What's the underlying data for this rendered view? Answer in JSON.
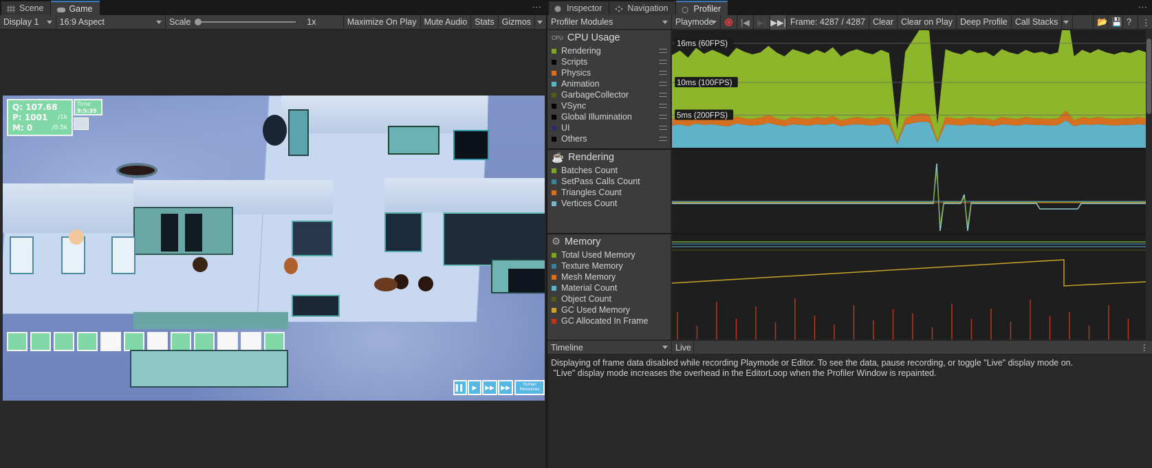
{
  "left_tabs": [
    {
      "name": "scene",
      "label": "Scene"
    },
    {
      "name": "game",
      "label": "Game"
    }
  ],
  "game_toolbar": {
    "display": "Display 1",
    "aspect": "16:9 Aspect",
    "scale_label": "Scale",
    "scale_value": "1x",
    "maximize": "Maximize On Play",
    "mute": "Mute Audio",
    "stats": "Stats",
    "gizmos": "Gizmos"
  },
  "hud": {
    "q": "Q: 107.68",
    "p": "P: 1001",
    "p_max": "/1k",
    "m": "M: 0",
    "m_max": "/0.5k",
    "time_label": "Time",
    "time": "9:5:39",
    "hr_button": "Human Resources"
  },
  "right_tabs": [
    {
      "name": "inspector",
      "label": "Inspector"
    },
    {
      "name": "navigation",
      "label": "Navigation"
    },
    {
      "name": "profiler",
      "label": "Profiler"
    }
  ],
  "profiler_toolbar": {
    "modules": "Profiler Modules",
    "target": "Playmode",
    "frame": "Frame: 4287 / 4287",
    "clear": "Clear",
    "clear_on_play": "Clear on Play",
    "deep_profile": "Deep Profile",
    "call_stacks": "Call Stacks"
  },
  "modules": {
    "cpu": {
      "title": "CPU Usage",
      "items": [
        {
          "label": "Rendering",
          "color": "#7ca42a"
        },
        {
          "label": "Scripts",
          "color": "#000000"
        },
        {
          "label": "Physics",
          "color": "#d4701f"
        },
        {
          "label": "Animation",
          "color": "#5fb3c8"
        },
        {
          "label": "GarbageCollector",
          "color": "#4f5b1e"
        },
        {
          "label": "VSync",
          "color": "#000000"
        },
        {
          "label": "Global Illumination",
          "color": "#000000"
        },
        {
          "label": "UI",
          "color": "#2a2a6a"
        },
        {
          "label": "Others",
          "color": "#000000"
        }
      ]
    },
    "rendering": {
      "title": "Rendering",
      "items": [
        {
          "label": "Batches Count",
          "color": "#7ca42a"
        },
        {
          "label": "SetPass Calls Count",
          "color": "#3f7f9a"
        },
        {
          "label": "Triangles Count",
          "color": "#d4701f"
        },
        {
          "label": "Vertices Count",
          "color": "#78b7c7"
        }
      ]
    },
    "memory": {
      "title": "Memory",
      "items": [
        {
          "label": "Total Used Memory",
          "color": "#7ca42a"
        },
        {
          "label": "Texture Memory",
          "color": "#3f7f9a"
        },
        {
          "label": "Mesh Memory",
          "color": "#d4701f"
        },
        {
          "label": "Material Count",
          "color": "#5fb3c8"
        },
        {
          "label": "Object Count",
          "color": "#4f5b1e"
        },
        {
          "label": "GC Used Memory",
          "color": "#c8a22a"
        },
        {
          "label": "GC Allocated In Frame",
          "color": "#b53a1f"
        }
      ]
    }
  },
  "chart_data": {
    "type": "area",
    "title": "CPU Usage",
    "markers": [
      "16ms (60FPS)",
      "10ms (100FPS)",
      "5ms (200FPS)"
    ],
    "series": [
      {
        "name": "Rendering",
        "values": [
          9.8,
          10.2,
          9.6,
          10.4,
          9.9,
          10.3,
          10.1,
          9.7,
          10.5,
          10.2,
          9.9,
          10.0,
          10.6,
          10.1,
          9.8,
          10.4,
          10.2,
          9.9,
          10.3,
          10.0,
          10.5,
          9.8,
          10.2,
          10.4,
          10.1,
          9.9,
          10.3,
          10.0,
          2.0,
          10.2,
          11.6,
          13.2,
          12.8,
          2.5,
          10.4,
          10.1,
          9.9,
          10.3,
          10.0,
          10.2,
          9.8,
          10.4,
          10.1,
          9.9,
          10.3,
          10.0,
          10.2,
          9.9,
          10.1,
          16.0,
          9.8,
          10.3,
          10.0,
          10.4,
          10.1,
          9.9,
          10.2,
          10.0,
          10.3,
          10.1
        ]
      },
      {
        "name": "Physics",
        "values": [
          1.0,
          1.1,
          0.9,
          1.2,
          1.0,
          1.1,
          1.0,
          0.9,
          1.1,
          1.0,
          1.0,
          1.1,
          1.2,
          1.0,
          0.9,
          1.1,
          1.0,
          1.0,
          1.1,
          1.0,
          1.2,
          0.9,
          1.0,
          1.1,
          1.0,
          1.0,
          1.1,
          1.0,
          0.2,
          1.0,
          1.2,
          1.3,
          1.2,
          0.3,
          1.1,
          1.0,
          1.0,
          1.1,
          1.0,
          1.0,
          0.9,
          1.1,
          1.0,
          1.0,
          1.1,
          1.0,
          1.0,
          1.0,
          1.0,
          1.5,
          0.9,
          1.1,
          1.0,
          1.1,
          1.0,
          1.0,
          1.0,
          1.0,
          1.1,
          1.0
        ]
      },
      {
        "name": "Animation",
        "values": [
          3.4,
          3.6,
          3.3,
          3.7,
          3.5,
          3.6,
          3.4,
          3.3,
          3.7,
          3.5,
          3.4,
          3.5,
          3.8,
          3.5,
          3.3,
          3.6,
          3.5,
          3.4,
          3.6,
          3.5,
          3.7,
          3.3,
          3.5,
          3.6,
          3.5,
          3.4,
          3.6,
          3.5,
          0.6,
          3.5,
          3.8,
          4.0,
          3.9,
          0.8,
          3.6,
          3.5,
          3.4,
          3.6,
          3.5,
          3.5,
          3.3,
          3.6,
          3.5,
          3.4,
          3.6,
          3.5,
          3.5,
          3.4,
          3.5,
          4.2,
          3.3,
          3.6,
          3.5,
          3.6,
          3.5,
          3.4,
          3.5,
          3.5,
          3.6,
          3.5
        ]
      }
    ],
    "ylim": [
      0,
      18
    ]
  },
  "details": {
    "view": "Timeline",
    "mode": "Live",
    "message": "Displaying of frame data disabled while recording Playmode or Editor. To see the data, pause recording, or toggle \"Live\" display mode on.\n \"Live\" display mode increases the overhead in the EditorLoop when the Profiler Window is repainted."
  }
}
